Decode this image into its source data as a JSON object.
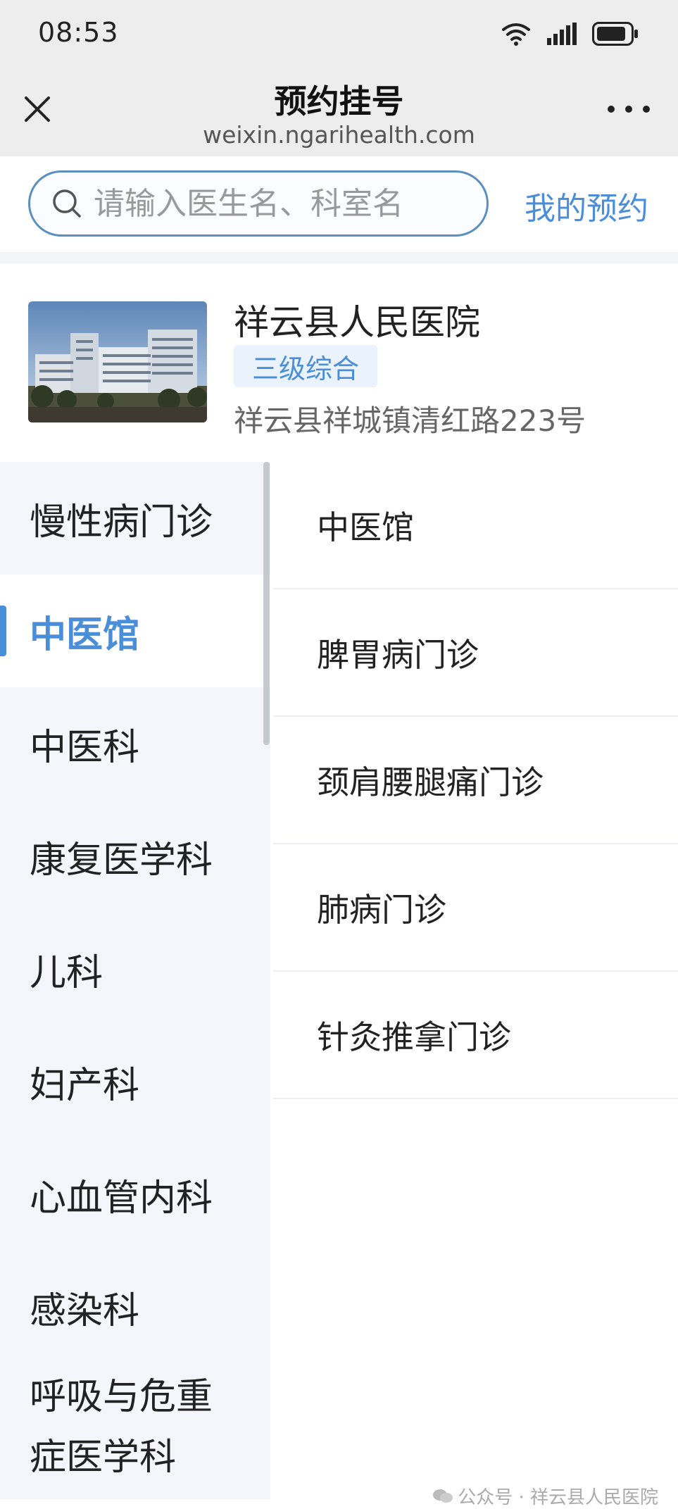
{
  "status_bar": {
    "time": "08:53",
    "icons": [
      "wifi-icon",
      "signal-icon",
      "battery-icon"
    ]
  },
  "nav": {
    "title": "预约挂号",
    "subtitle": "weixin.ngarihealth.com",
    "icons": [
      "close-icon",
      "more-icon"
    ]
  },
  "search": {
    "placeholder": "请输入医生名、科室名",
    "value": "",
    "my_appointment_label": "我的预约"
  },
  "hospital": {
    "name": "祥云县人民医院",
    "level_tag": "三级综合",
    "address": "祥云县祥城镇清红路223号"
  },
  "departments": [
    {
      "label": "慢性病门诊",
      "active": false
    },
    {
      "label": "中医馆",
      "active": true
    },
    {
      "label": "中医科",
      "active": false
    },
    {
      "label": "康复医学科",
      "active": false
    },
    {
      "label": "儿科",
      "active": false
    },
    {
      "label": "妇产科",
      "active": false
    },
    {
      "label": "心血管内科",
      "active": false
    },
    {
      "label": "感染科",
      "active": false
    },
    {
      "label": "呼吸与危重\n症医学科",
      "active": false
    }
  ],
  "sub_departments": [
    {
      "label": "中医馆"
    },
    {
      "label": "脾胃病门诊"
    },
    {
      "label": "颈肩腰腿痛门诊"
    },
    {
      "label": "肺病门诊"
    },
    {
      "label": "针灸推拿门诊"
    }
  ],
  "watermark": {
    "text": "公众号 · 祥云县人民医院"
  },
  "colors": {
    "accent": "#4a8ed9",
    "sidebar_bg": "#f4f6fb",
    "nav_bg": "#ededed"
  }
}
